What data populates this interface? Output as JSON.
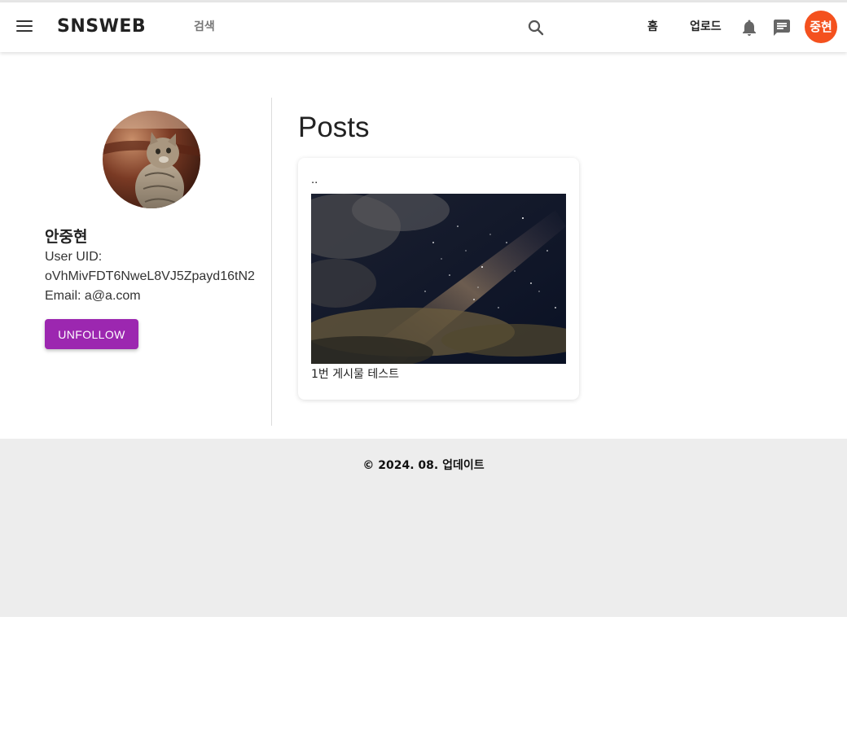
{
  "header": {
    "brand": "SNSWEB",
    "search_placeholder": "검색",
    "nav_home": "홈",
    "nav_upload": "업로드",
    "avatar_text": "중현",
    "accent_color": "#f4511e"
  },
  "profile": {
    "name": "안중현",
    "uid_label": "User UID:",
    "uid_value": "oVhMivFDT6NweL8VJ5Zpayd16tN2",
    "email_line": "Email: a@a.com",
    "unfollow_label": "UNFOLLOW",
    "button_color": "#9c27b0"
  },
  "posts": {
    "heading": "Posts",
    "items": [
      {
        "title": "..",
        "caption": "1번 게시물 테스트"
      }
    ]
  },
  "footer": {
    "text": "© 2024. 08. 업데이트"
  }
}
